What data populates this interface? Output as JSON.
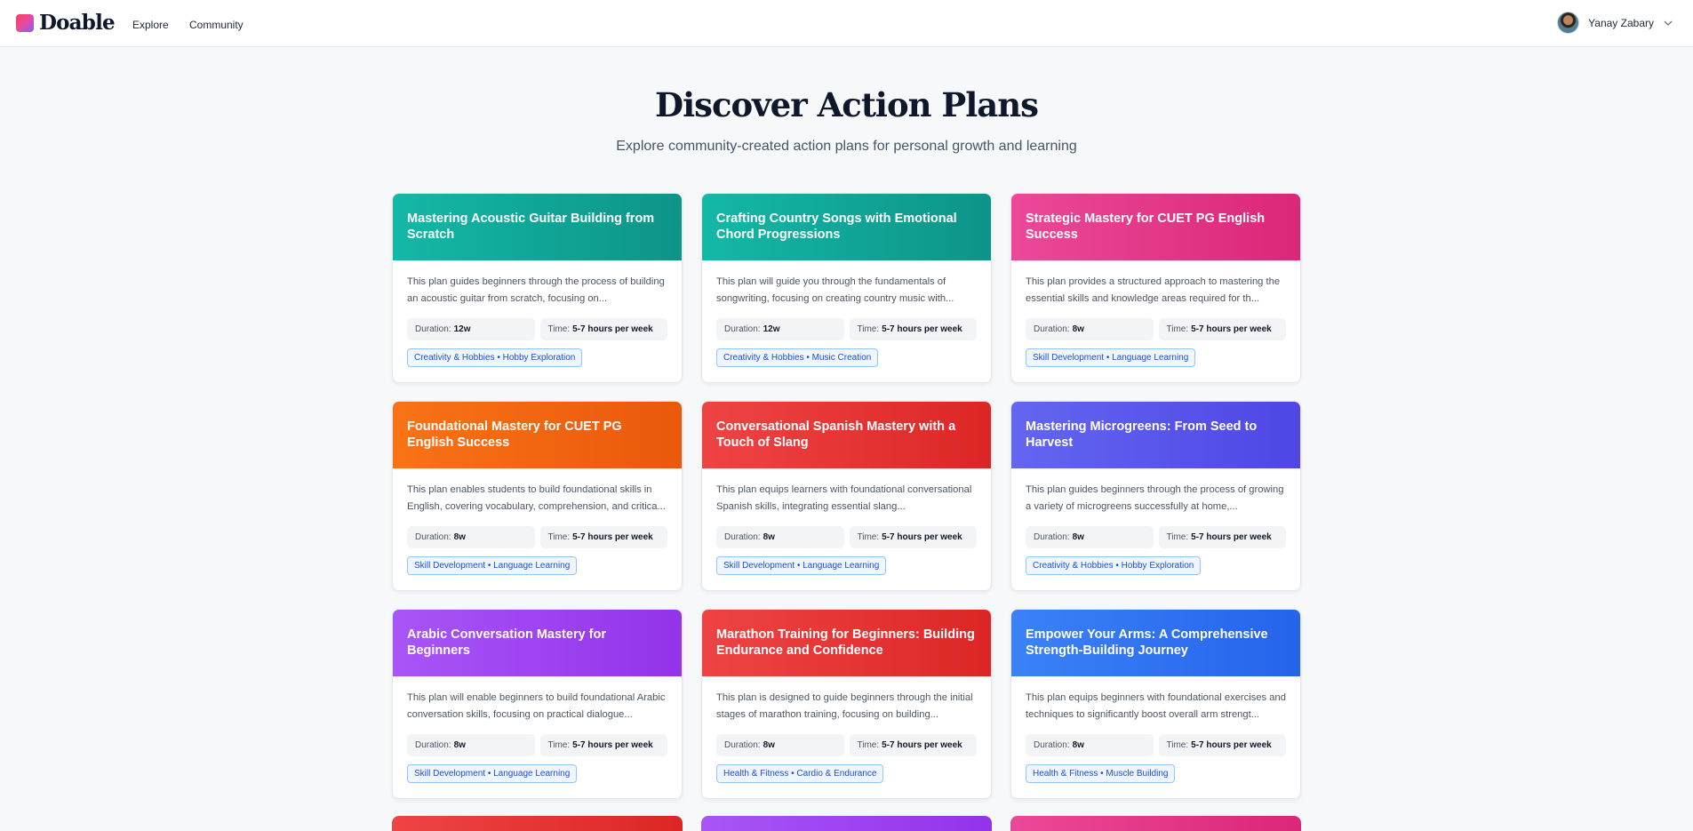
{
  "app": {
    "brand": "Doable",
    "nav": [
      {
        "label": "Explore"
      },
      {
        "label": "Community"
      }
    ],
    "user": {
      "name": "Yanay Zabary"
    }
  },
  "header": {
    "title": "Discover Action Plans",
    "subtitle": "Explore community-created action plans for personal growth and learning"
  },
  "labels": {
    "duration": "Duration:",
    "time": "Time:"
  },
  "plans": [
    {
      "title": "Mastering Acoustic Guitar Building from Scratch",
      "description": "This plan guides beginners through the process of building an acoustic guitar from scratch, focusing on...",
      "duration": "12w",
      "time": "5-7 hours per week",
      "tag": "Creativity & Hobbies • Hobby Exploration",
      "color": "#14b8a6"
    },
    {
      "title": "Crafting Country Songs with Emotional Chord Progressions",
      "description": "This plan will guide you through the fundamentals of songwriting, focusing on creating country music with...",
      "duration": "12w",
      "time": "5-7 hours per week",
      "tag": "Creativity & Hobbies • Music Creation",
      "color": "#14b8a6"
    },
    {
      "title": "Strategic Mastery for CUET PG English Success",
      "description": "This plan provides a structured approach to mastering the essential skills and knowledge areas required for th...",
      "duration": "8w",
      "time": "5-7 hours per week",
      "tag": "Skill Development • Language Learning",
      "color": "#ec4899"
    },
    {
      "title": "Foundational Mastery for CUET PG English Success",
      "description": "This plan enables students to build foundational skills in English, covering vocabulary, comprehension, and critica...",
      "duration": "8w",
      "time": "5-7 hours per week",
      "tag": "Skill Development • Language Learning",
      "color": "#f97316"
    },
    {
      "title": "Conversational Spanish Mastery with a Touch of Slang",
      "description": "This plan equips learners with foundational conversational Spanish skills, integrating essential slang...",
      "duration": "8w",
      "time": "5-7 hours per week",
      "tag": "Skill Development • Language Learning",
      "color": "#ef4444"
    },
    {
      "title": "Mastering Microgreens: From Seed to Harvest",
      "description": "This plan guides beginners through the process of growing a variety of microgreens successfully at home,...",
      "duration": "8w",
      "time": "5-7 hours per week",
      "tag": "Creativity & Hobbies • Hobby Exploration",
      "color": "#6366f1"
    },
    {
      "title": "Arabic Conversation Mastery for Beginners",
      "description": "This plan will enable beginners to build foundational Arabic conversation skills, focusing on practical dialogue...",
      "duration": "8w",
      "time": "5-7 hours per week",
      "tag": "Skill Development • Language Learning",
      "color": "#a855f7"
    },
    {
      "title": "Marathon Training for Beginners: Building Endurance and Confidence",
      "description": "This plan is designed to guide beginners through the initial stages of marathon training, focusing on building...",
      "duration": "8w",
      "time": "5-7 hours per week",
      "tag": "Health & Fitness • Cardio & Endurance",
      "color": "#ef4444"
    },
    {
      "title": "Empower Your Arms: A Comprehensive Strength-Building Journey",
      "description": "This plan equips beginners with foundational exercises and techniques to significantly boost overall arm strengt...",
      "duration": "8w",
      "time": "5-7 hours per week",
      "tag": "Health & Fitness • Muscle Building",
      "color": "#3b82f6"
    }
  ]
}
